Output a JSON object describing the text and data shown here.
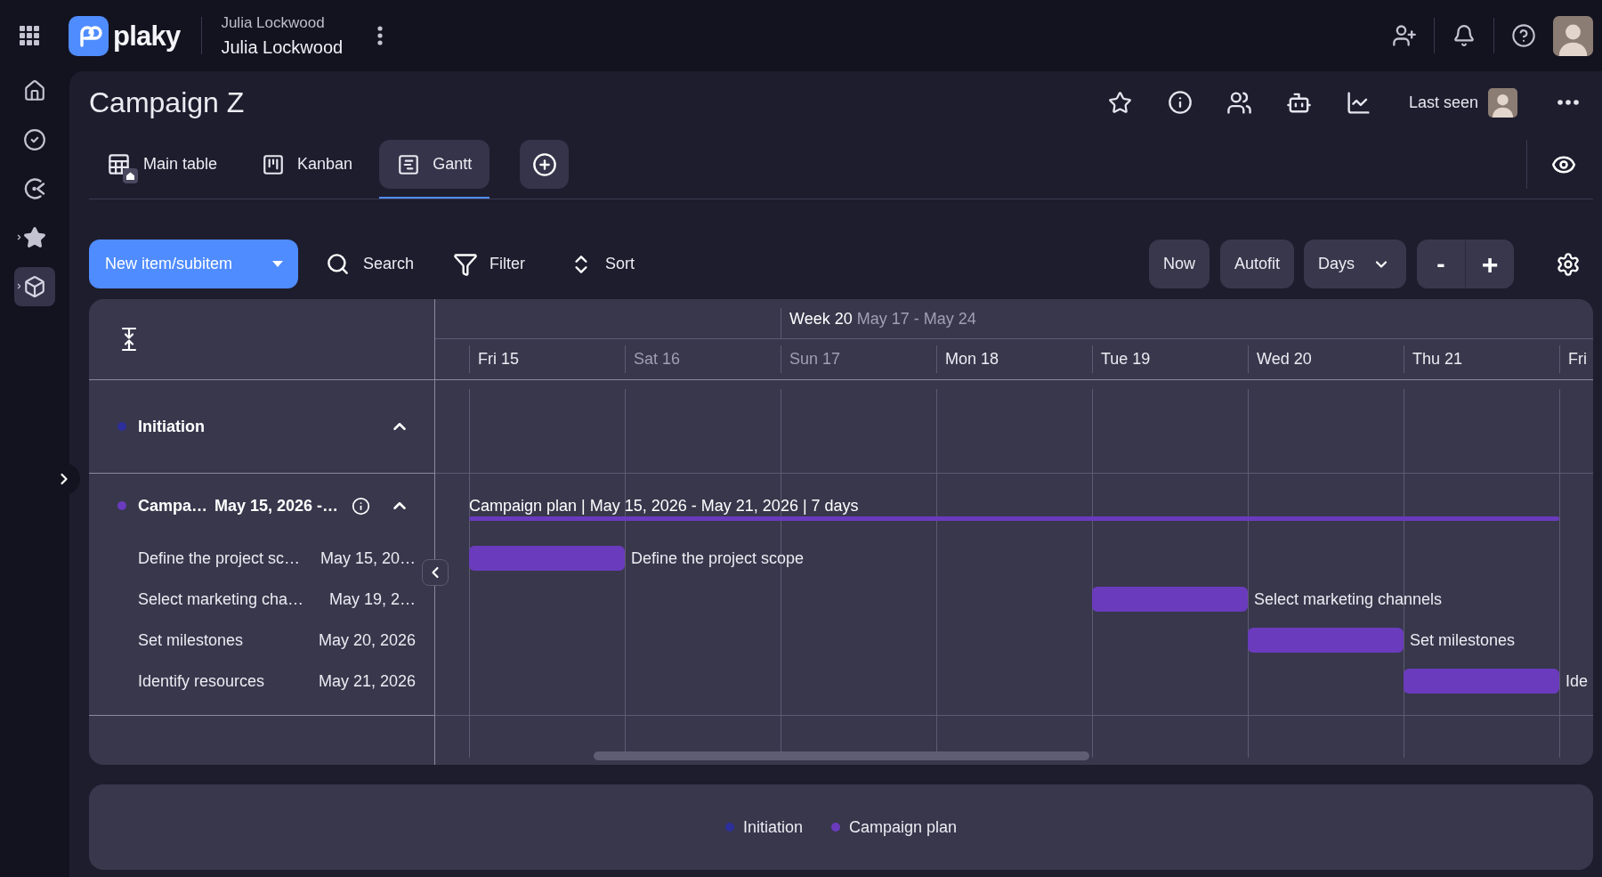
{
  "app_bar": {
    "brand": "plaky",
    "account_label": "Julia Lockwood",
    "account_name": "Julia Lockwood"
  },
  "rail": [
    {
      "selected": false,
      "submenu": false
    },
    {
      "selected": false,
      "submenu": false
    },
    {
      "selected": false,
      "submenu": false
    },
    {
      "selected": false,
      "submenu": true
    },
    {
      "selected": true,
      "submenu": true
    }
  ],
  "board": {
    "title": "Campaign Z",
    "last_seen": "Last seen",
    "views": [
      {
        "label": "Main table",
        "selected": false,
        "default": true
      },
      {
        "label": "Kanban",
        "selected": false,
        "default": false
      },
      {
        "label": "Gantt",
        "selected": true,
        "default": false
      }
    ]
  },
  "toolbar": {
    "new_item": "New item/subitem",
    "search": "Search",
    "filter": "Filter",
    "sort": "Sort",
    "now": "Now",
    "autofit": "Autofit",
    "scale": "Days",
    "zoom_out": "-",
    "zoom_in": "+"
  },
  "gantt": {
    "weeks": [
      {
        "days": [
          {
            "label": "Fri 15",
            "weekend": false
          },
          {
            "label": "Sat 16",
            "weekend": true
          }
        ]
      },
      {
        "label": "Week 20",
        "range": "May 17 - May 24",
        "days": [
          {
            "label": "Sun 17",
            "weekend": true
          },
          {
            "label": "Mon 18",
            "weekend": false
          },
          {
            "label": "Tue 19",
            "weekend": false
          },
          {
            "label": "Wed 20",
            "weekend": false
          },
          {
            "label": "Thu 21",
            "weekend": false
          },
          {
            "label": "Fri",
            "weekend": false
          }
        ]
      }
    ],
    "groups": [
      {
        "name": "Initiation",
        "color": "#2d2f9a",
        "expanded": true,
        "info": false
      },
      {
        "name": "Campa…",
        "dates": "May 15, 2026 -…",
        "color": "#6a3bbd",
        "expanded": true,
        "info": true,
        "summary": "Campaign plan | May 15, 2026 - May 21, 2026 | 7 days",
        "tasks": [
          {
            "name": "Define the project sc…",
            "date": "May 15, 20…",
            "bar_label": "Define the project scope",
            "slots": [
              {
                "kind": "bar"
              }
            ]
          },
          {
            "name": "Select marketing cha…",
            "date": "May 19, 2…",
            "bar_label": "Select marketing channels",
            "slots": [
              {
                "kind": "gap"
              },
              {
                "kind": "gap"
              },
              {
                "kind": "gap"
              },
              {
                "kind": "gap"
              },
              {
                "kind": "bar"
              }
            ]
          },
          {
            "name": "Set milestones",
            "date": "May 20, 2026",
            "bar_label": "Set milestones",
            "slots": [
              {
                "kind": "gap"
              },
              {
                "kind": "gap"
              },
              {
                "kind": "gap"
              },
              {
                "kind": "gap"
              },
              {
                "kind": "gap"
              },
              {
                "kind": "bar"
              }
            ]
          },
          {
            "name": "Identify resources",
            "date": "May 21, 2026",
            "bar_label": "Ide",
            "slots": [
              {
                "kind": "gap"
              },
              {
                "kind": "gap"
              },
              {
                "kind": "gap"
              },
              {
                "kind": "gap"
              },
              {
                "kind": "gap"
              },
              {
                "kind": "gap"
              },
              {
                "kind": "bar"
              }
            ]
          }
        ]
      }
    ]
  },
  "legend": [
    {
      "name": "Initiation",
      "color": "#2d2f9a"
    },
    {
      "name": "Campaign plan",
      "color": "#6a3bbd"
    }
  ]
}
